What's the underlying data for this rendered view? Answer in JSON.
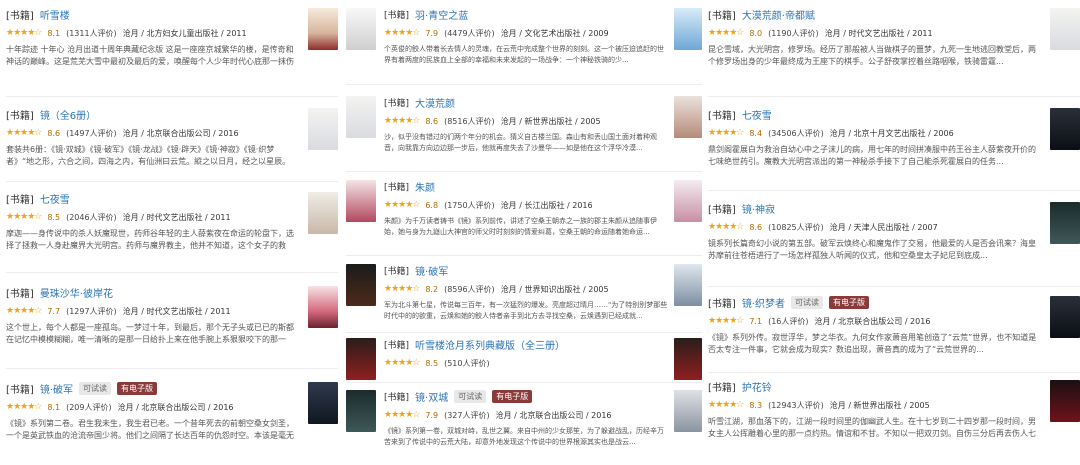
{
  "col1": [
    {
      "tag": "[书籍]",
      "title": "听雪楼",
      "stars": "★★★★☆",
      "score": "8.1",
      "reviews": "(1311人评价)",
      "publisher": "沧月 / 北方妇女儿童出版社 / 2011",
      "desc": "十年踪迹 十年心 沧月出道十周年典藏纪念版 这是一座座京城繁华的楼，是传奇和神话的巅峰。这是荒芜大雪中最初及最后的爱，唤醒每个人少年时代心底那一抹伤痛记忆。",
      "cover": "cv-a"
    },
    {
      "tag": "[书籍]",
      "title": "镜（全6册）",
      "stars": "★★★★☆",
      "score": "8.6",
      "reviews": "(1497人评价)",
      "publisher": "沧月 / 北京联合出版公司 / 2016",
      "desc": "套装共6册：《镜·双城》《镜·破军》《镜·龙战》《镜·辟天》《镜·神寂》《镜·织梦者》“地之形，六合之间，四海之内，有仙洲曰云荒。縱之以日月，经之以星辰。",
      "cover": "cv-b"
    },
    {
      "tag": "[书籍]",
      "title": "七夜雪",
      "stars": "★★★★☆",
      "score": "8.5",
      "reviews": "(2046人评价)",
      "publisher": "沧月 / 时代文艺出版社 / 2011",
      "desc": "摩迦——身传说中的杀人妖魔现世，药师谷年轻的主人薛紫夜在命运的轮盘下，选择了拯救一人身赴魔界大光明宫。药师与魔界教主，他并不知道，这个女子的救赎，换来的是一场...",
      "cover": "cv-c"
    },
    {
      "tag": "[书籍]",
      "title": "曼珠沙华·彼岸花",
      "stars": "★★★★☆",
      "score": "7.7",
      "reviews": "(1297人评价)",
      "publisher": "沧月 / 时代文艺出版社 / 2011",
      "desc": "这个世上，每个人都是一座孤岛。一梦过十年，到最后，那个无子头或已已的斯都在记忆中模模糊糊，唯一清晰的是那一日给扑上来在他手腕上系狠狠咬下的那一口。南宫说能然...",
      "cover": "cv-d"
    },
    {
      "tag": "[书籍]",
      "title": "镜·破军",
      "badge1": "可试读",
      "badge2": "有电子版",
      "stars": "★★★★☆",
      "score": "8.1",
      "reviews": "(209人评价)",
      "publisher": "沧月 / 北京联合出版公司 / 2016",
      "desc": "《镜》系列第二卷。君生我未生，我生君已老。一个昔年死去的前朝空桑女剑圣，一个是英武铁血的沧流帝国少将。他们之间隔了长达百年的仇怨时空。本该是毫无交集的不同人...",
      "cover": "cv-e"
    }
  ],
  "col2": [
    {
      "tag": "[书籍]",
      "title": "羽·青空之蓝",
      "stars": "★★★★☆",
      "score": "7.9",
      "reviews": "(4479人评价)",
      "publisher": "沧月 / 文化艺术出版社 / 2009",
      "desc": "个英俊的鲛人带着长去情人的灵魂，在云荒中完成整个世界的刻刻。这一个被压迫追赶的世界有着两度的民族血上全部的幸福和未来发起的一场战争：一个神秘铁骑的少...",
      "coverL": "cv-f",
      "coverR": "cv-g"
    },
    {
      "tag": "[书籍]",
      "title": "大漠荒颜",
      "stars": "★★★★☆",
      "score": "8.6",
      "reviews": "(8516人评价)",
      "publisher": "沧月 / 新世界出版社 / 2005",
      "desc": "沙，似乎没有错过的们两个年分的机会。猜义自古楼兰国。森山有和丢山国土面对着种观音，向我靠方向边边那一步后，他就再度失去了沙曼华——如是他在这个浮华冷漠...",
      "coverL": "cv-b",
      "coverR": "cv-h"
    },
    {
      "tag": "[书籍]",
      "title": "朱颜",
      "stars": "★★★★☆",
      "score": "6.8",
      "reviews": "(1750人评价)",
      "publisher": "沧月 / 长江出版社 / 2016",
      "desc": "朱颜》为千万读者铸书《镜》系列前传，讲述了空桑王朝赤之一族的郡主朱颜从追随事伊始，她与身为九嶷山大神官的师父时时刻刻的情爱纠葛，空桑王朝的命运随着她命运...",
      "coverL": "cv-i",
      "coverR": "cv-j"
    },
    {
      "tag": "[书籍]",
      "title": "镜·破军",
      "stars": "★★★★☆",
      "score": "8.2",
      "reviews": "(8596人评价)",
      "publisher": "沧月 / 世界知识出版社 / 2005",
      "desc": "军为北斗第七星，传说每三百年，有一次猛烈的爆发。亮度超过晴月……\"为了特别别梦那些时代中的的欲重，云焕和她的鲛人侍者亲手到北方去寻找空桑，云焕遇到已经成就...",
      "coverL": "cv-k",
      "coverR": "cv-l"
    },
    {
      "tag": "[书籍]",
      "title": "听雪楼沧月系列典藏版（全三册）",
      "stars": "★★★★☆",
      "score": "8.5",
      "reviews": "(510人评价)",
      "publisher": "",
      "desc": "",
      "coverL": "cv-m",
      "coverR": "cv-m"
    },
    {
      "tag": "[书籍]",
      "title": "镜·双城",
      "badge1": "可试读",
      "badge2": "有电子版",
      "stars": "★★★★☆",
      "score": "7.9",
      "reviews": "(327人评价)",
      "publisher": "沧月 / 北京联合出版公司 / 2016",
      "desc": "《镜》系列第一卷，双城对峙，乱世之翼。来自中州的少女那笙，为了躲避战乱，历经辛万苦来到了传说中的云荒大陆，却意外地发现这个传说中的世界根源其实也是战云...",
      "coverL": "cv-n",
      "coverR": "cv-p"
    }
  ],
  "col3": [
    {
      "tag": "[书籍]",
      "title": "大漠荒颜·帝都赋",
      "stars": "★★★★☆",
      "score": "8.0",
      "reviews": "(1190人评价)",
      "publisher": "沧月 / 时代文艺出版社 / 2011",
      "desc": "昆仑雪域，大光明宫，修罗场。经历了那般被人当做棋子的噩梦，九死一生地逃回教堂后，两个修罗场出身的少年最终成为王座下的棋手。公子舒夜掌控着丝路咽喉，铁骑雷霆...",
      "cover": "cv-b"
    },
    {
      "tag": "[书籍]",
      "title": "七夜雪",
      "stars": "★★★★☆",
      "score": "8.4",
      "reviews": "(34506人评价)",
      "publisher": "沧月 / 北京十月文艺出版社 / 2006",
      "desc": "鼎剑阁霍展白为救治自幼心中之子沫儿的病，用七年的时间拼凑服中药王谷主人薛紫夜开价的七味绝世药引。魔教大光明宫派出的第一神秘杀手接下了自己能杀死霍展白的任务...",
      "cover": "cv-q"
    },
    {
      "tag": "[书籍]",
      "title": "镜·神寂",
      "stars": "★★★★☆",
      "score": "8.6",
      "reviews": "(10825人评价)",
      "publisher": "沧月 / 天津人民出版社 / 2007",
      "desc": "镜系列长篇奇幻小说的第五部。破军云焕终心和魔鬼作了交易，他最爱的人是否会讯来？海皇苏摩前往苍梧进行了一场怎样孤独人听闻的仪式，他和空桑皇太子妃尼到底成...",
      "cover": "cv-n"
    },
    {
      "tag": "[书籍]",
      "title": "镜·织梦者",
      "badge1": "可试读",
      "badge2": "有电子版",
      "stars": "★★★★☆",
      "score": "7.1",
      "reviews": "(16人评价)",
      "publisher": "沧月 / 北京联合出版公司 / 2016",
      "desc": "《镜》系列外传。寂世浮华，梦之华衣。九何女作家萧音用笔创造了“云荒”世界，也不知道是否太专注一件事，它就会成为现实？数追出现，萧音真的成为了“云荒世界的...",
      "cover": "cv-q"
    },
    {
      "tag": "[书籍]",
      "title": "护花铃",
      "stars": "★★★★☆",
      "score": "8.3",
      "reviews": "(12943人评价)",
      "publisher": "沧月 / 新世界出版社 / 2005",
      "desc": "听雪江湖，那血落下的，江湖一段时间里的伽幽武人生。在十七岁到二十四岁那一段时间，男女主人公挥雕着心里的那一点约热。情谊和不甘。不知以一把双刃剑。自伤三分后再去伤人七分。...",
      "cover": "cv-o"
    }
  ]
}
